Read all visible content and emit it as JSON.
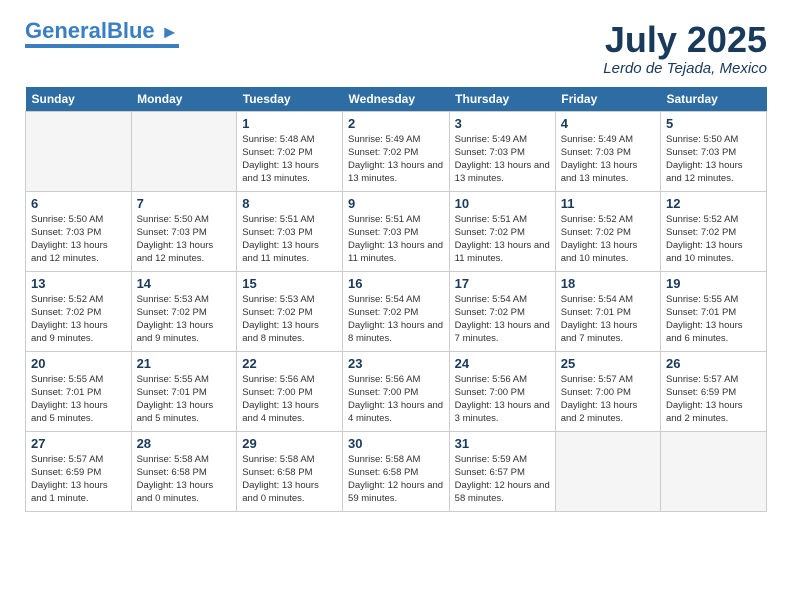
{
  "header": {
    "logo_general": "General",
    "logo_blue": "Blue",
    "month": "July 2025",
    "location": "Lerdo de Tejada, Mexico"
  },
  "days_of_week": [
    "Sunday",
    "Monday",
    "Tuesday",
    "Wednesday",
    "Thursday",
    "Friday",
    "Saturday"
  ],
  "weeks": [
    [
      {
        "day": "",
        "info": ""
      },
      {
        "day": "",
        "info": ""
      },
      {
        "day": "1",
        "info": "Sunrise: 5:48 AM\nSunset: 7:02 PM\nDaylight: 13 hours and 13 minutes."
      },
      {
        "day": "2",
        "info": "Sunrise: 5:49 AM\nSunset: 7:02 PM\nDaylight: 13 hours and 13 minutes."
      },
      {
        "day": "3",
        "info": "Sunrise: 5:49 AM\nSunset: 7:03 PM\nDaylight: 13 hours and 13 minutes."
      },
      {
        "day": "4",
        "info": "Sunrise: 5:49 AM\nSunset: 7:03 PM\nDaylight: 13 hours and 13 minutes."
      },
      {
        "day": "5",
        "info": "Sunrise: 5:50 AM\nSunset: 7:03 PM\nDaylight: 13 hours and 12 minutes."
      }
    ],
    [
      {
        "day": "6",
        "info": "Sunrise: 5:50 AM\nSunset: 7:03 PM\nDaylight: 13 hours and 12 minutes."
      },
      {
        "day": "7",
        "info": "Sunrise: 5:50 AM\nSunset: 7:03 PM\nDaylight: 13 hours and 12 minutes."
      },
      {
        "day": "8",
        "info": "Sunrise: 5:51 AM\nSunset: 7:03 PM\nDaylight: 13 hours and 11 minutes."
      },
      {
        "day": "9",
        "info": "Sunrise: 5:51 AM\nSunset: 7:03 PM\nDaylight: 13 hours and 11 minutes."
      },
      {
        "day": "10",
        "info": "Sunrise: 5:51 AM\nSunset: 7:02 PM\nDaylight: 13 hours and 11 minutes."
      },
      {
        "day": "11",
        "info": "Sunrise: 5:52 AM\nSunset: 7:02 PM\nDaylight: 13 hours and 10 minutes."
      },
      {
        "day": "12",
        "info": "Sunrise: 5:52 AM\nSunset: 7:02 PM\nDaylight: 13 hours and 10 minutes."
      }
    ],
    [
      {
        "day": "13",
        "info": "Sunrise: 5:52 AM\nSunset: 7:02 PM\nDaylight: 13 hours and 9 minutes."
      },
      {
        "day": "14",
        "info": "Sunrise: 5:53 AM\nSunset: 7:02 PM\nDaylight: 13 hours and 9 minutes."
      },
      {
        "day": "15",
        "info": "Sunrise: 5:53 AM\nSunset: 7:02 PM\nDaylight: 13 hours and 8 minutes."
      },
      {
        "day": "16",
        "info": "Sunrise: 5:54 AM\nSunset: 7:02 PM\nDaylight: 13 hours and 8 minutes."
      },
      {
        "day": "17",
        "info": "Sunrise: 5:54 AM\nSunset: 7:02 PM\nDaylight: 13 hours and 7 minutes."
      },
      {
        "day": "18",
        "info": "Sunrise: 5:54 AM\nSunset: 7:01 PM\nDaylight: 13 hours and 7 minutes."
      },
      {
        "day": "19",
        "info": "Sunrise: 5:55 AM\nSunset: 7:01 PM\nDaylight: 13 hours and 6 minutes."
      }
    ],
    [
      {
        "day": "20",
        "info": "Sunrise: 5:55 AM\nSunset: 7:01 PM\nDaylight: 13 hours and 5 minutes."
      },
      {
        "day": "21",
        "info": "Sunrise: 5:55 AM\nSunset: 7:01 PM\nDaylight: 13 hours and 5 minutes."
      },
      {
        "day": "22",
        "info": "Sunrise: 5:56 AM\nSunset: 7:00 PM\nDaylight: 13 hours and 4 minutes."
      },
      {
        "day": "23",
        "info": "Sunrise: 5:56 AM\nSunset: 7:00 PM\nDaylight: 13 hours and 4 minutes."
      },
      {
        "day": "24",
        "info": "Sunrise: 5:56 AM\nSunset: 7:00 PM\nDaylight: 13 hours and 3 minutes."
      },
      {
        "day": "25",
        "info": "Sunrise: 5:57 AM\nSunset: 7:00 PM\nDaylight: 13 hours and 2 minutes."
      },
      {
        "day": "26",
        "info": "Sunrise: 5:57 AM\nSunset: 6:59 PM\nDaylight: 13 hours and 2 minutes."
      }
    ],
    [
      {
        "day": "27",
        "info": "Sunrise: 5:57 AM\nSunset: 6:59 PM\nDaylight: 13 hours and 1 minute."
      },
      {
        "day": "28",
        "info": "Sunrise: 5:58 AM\nSunset: 6:58 PM\nDaylight: 13 hours and 0 minutes."
      },
      {
        "day": "29",
        "info": "Sunrise: 5:58 AM\nSunset: 6:58 PM\nDaylight: 13 hours and 0 minutes."
      },
      {
        "day": "30",
        "info": "Sunrise: 5:58 AM\nSunset: 6:58 PM\nDaylight: 12 hours and 59 minutes."
      },
      {
        "day": "31",
        "info": "Sunrise: 5:59 AM\nSunset: 6:57 PM\nDaylight: 12 hours and 58 minutes."
      },
      {
        "day": "",
        "info": ""
      },
      {
        "day": "",
        "info": ""
      }
    ]
  ]
}
